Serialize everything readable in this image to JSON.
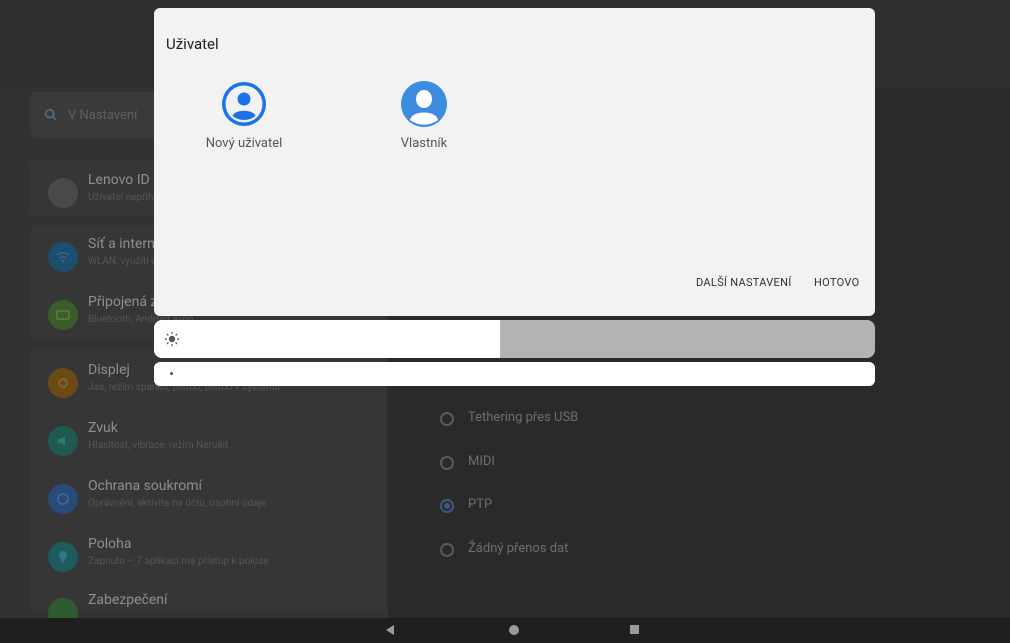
{
  "background": {
    "search_placeholder": "V Nastavení",
    "account": {
      "title": "Lenovo ID",
      "subtitle": "Uživatel nepřihlášen"
    },
    "settings": [
      {
        "title": "Síť a internet",
        "subtitle": "WLAN, využití dat, hotspot",
        "icon": "wifi-icon",
        "color": "#1d4e6e"
      },
      {
        "title": "Připojená zařízení",
        "subtitle": "Bluetooth, Android Auto",
        "icon": "devices-icon",
        "color": "#3b5d2c"
      },
      {
        "title": "Displej",
        "subtitle": "Jas, režim spánku, písmo, písmo v systému",
        "icon": "display-icon",
        "color": "#6b4a16"
      },
      {
        "title": "Zvuk",
        "subtitle": "Hlasitost, vibrace, režim Nerušit",
        "icon": "sound-icon",
        "color": "#1e5a52"
      },
      {
        "title": "Ochrana soukromí",
        "subtitle": "Oprávnění, aktivita na účtu, osobní údaje",
        "icon": "privacy-icon",
        "color": "#2a4a78"
      },
      {
        "title": "Poloha",
        "subtitle": "Zapnuto – 7 aplikací má přístup k poloze",
        "icon": "location-icon",
        "color": "#1e5a5e"
      },
      {
        "title": "Zabezpečení",
        "subtitle": "",
        "icon": "lock-icon",
        "color": "#2f5a2f"
      }
    ],
    "usb_options": [
      {
        "label": "Tethering přes USB",
        "selected": false
      },
      {
        "label": "MIDI",
        "selected": false
      },
      {
        "label": "PTP",
        "selected": true
      },
      {
        "label": "Žádný přenos dat",
        "selected": false
      }
    ]
  },
  "dialog": {
    "title": "Uživatel",
    "users": [
      {
        "name": "Nový uživatel",
        "icon": "account-circle-icon"
      },
      {
        "name": "Vlastník",
        "icon": "owner-avatar-icon"
      }
    ],
    "more_settings_label": "DALŠÍ NASTAVENÍ",
    "done_label": "HOTOVO"
  },
  "brightness": {
    "level_percent": 48,
    "icon": "brightness-icon"
  },
  "navbar": {
    "back_icon": "back-icon",
    "home_icon": "home-icon",
    "recents_icon": "recents-icon"
  },
  "colors": {
    "accent": "#1a73e8",
    "owner_avatar": "#3d8ce0"
  }
}
